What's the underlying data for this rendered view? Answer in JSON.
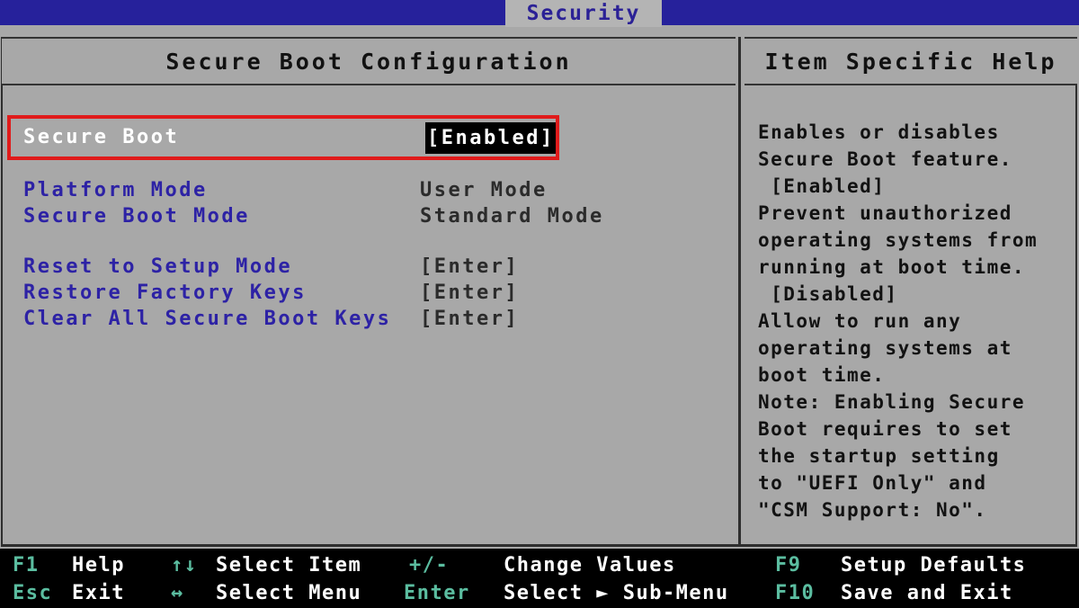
{
  "tab": {
    "label": "Security"
  },
  "main_panel": {
    "title": "Secure Boot Configuration",
    "rows": [
      {
        "label": "Secure Boot",
        "value": "[Enabled]",
        "label_style": "white",
        "value_style": "selected",
        "selected": true
      },
      {
        "label": "Platform Mode",
        "value": "User Mode",
        "label_style": "blue",
        "value_style": "dark",
        "selected": false
      },
      {
        "label": "Secure Boot Mode",
        "value": "Standard Mode",
        "label_style": "blue",
        "value_style": "dark",
        "selected": false
      },
      {
        "label": "Reset to Setup Mode",
        "value": "[Enter]",
        "label_style": "blue",
        "value_style": "dark",
        "selected": false
      },
      {
        "label": "Restore Factory Keys",
        "value": "[Enter]",
        "label_style": "blue",
        "value_style": "dark",
        "selected": false
      },
      {
        "label": "Clear All Secure Boot Keys",
        "value": "[Enter]",
        "label_style": "blue",
        "value_style": "dark",
        "selected": false
      }
    ]
  },
  "help_panel": {
    "title": "Item Specific Help",
    "lines": [
      "Enables or disables",
      "Secure Boot feature.",
      " [Enabled]",
      "Prevent unauthorized",
      "operating systems from",
      "running at boot time.",
      " [Disabled]",
      "Allow to run any",
      "operating systems at",
      "boot time.",
      "Note: Enabling Secure",
      "Boot requires to set",
      "the startup setting",
      "to \"UEFI Only\" and",
      "\"CSM Support: No\"."
    ]
  },
  "footer": {
    "items": [
      {
        "key": "F1",
        "desc": "Help"
      },
      {
        "key": "↑↓",
        "desc": "Select Item"
      },
      {
        "key": "+/-",
        "desc": "Change Values"
      },
      {
        "key": "F9",
        "desc": "Setup Defaults"
      },
      {
        "key": "Esc",
        "desc": "Exit"
      },
      {
        "key": "↔",
        "desc": "Select Menu"
      },
      {
        "key": "Enter",
        "desc": "Select ► Sub-Menu"
      },
      {
        "key": "F10",
        "desc": "Save and Exit"
      }
    ]
  },
  "annotation": {
    "highlight_color": "#e01b1b",
    "target_row": "Secure Boot"
  },
  "colors": {
    "background": "#a8a8a8",
    "tab_blue": "#26219b",
    "label_blue": "#2d22a5",
    "footer_bg": "#000000",
    "footer_key": "#5bbda0"
  }
}
